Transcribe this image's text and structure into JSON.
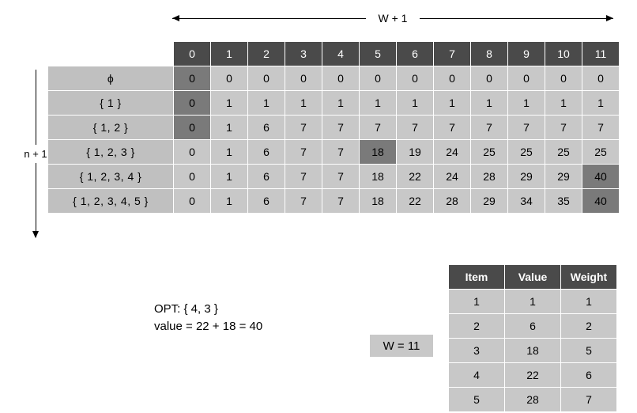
{
  "annotations": {
    "top_arrow_label": "W + 1",
    "left_arrow_label": "n + 1"
  },
  "dp_table": {
    "column_headers": [
      "0",
      "1",
      "2",
      "3",
      "4",
      "5",
      "6",
      "7",
      "8",
      "9",
      "10",
      "11"
    ],
    "row_labels": [
      "ϕ",
      "{ 1 }",
      "{ 1, 2 }",
      "{ 1, 2, 3 }",
      "{ 1, 2, 3, 4 }",
      "{ 1, 2, 3, 4, 5 }"
    ],
    "rows": [
      {
        "label": "ϕ",
        "values": [
          "0",
          "0",
          "0",
          "0",
          "0",
          "0",
          "0",
          "0",
          "0",
          "0",
          "0",
          "0"
        ],
        "highlighted": [
          0
        ]
      },
      {
        "label": "{ 1 }",
        "values": [
          "0",
          "1",
          "1",
          "1",
          "1",
          "1",
          "1",
          "1",
          "1",
          "1",
          "1",
          "1"
        ],
        "highlighted": [
          0
        ]
      },
      {
        "label": "{ 1, 2 }",
        "values": [
          "0",
          "1",
          "6",
          "7",
          "7",
          "7",
          "7",
          "7",
          "7",
          "7",
          "7",
          "7"
        ],
        "highlighted": [
          0
        ]
      },
      {
        "label": "{ 1, 2, 3 }",
        "values": [
          "0",
          "1",
          "6",
          "7",
          "7",
          "18",
          "19",
          "24",
          "25",
          "25",
          "25",
          "25"
        ],
        "highlighted": [
          5
        ]
      },
      {
        "label": "{ 1, 2, 3, 4 }",
        "values": [
          "0",
          "1",
          "6",
          "7",
          "7",
          "18",
          "22",
          "24",
          "28",
          "29",
          "29",
          "40"
        ],
        "highlighted": [
          11
        ]
      },
      {
        "label": "{ 1, 2, 3, 4, 5 }",
        "values": [
          "0",
          "1",
          "6",
          "7",
          "7",
          "18",
          "22",
          "28",
          "29",
          "34",
          "35",
          "40"
        ],
        "highlighted": [
          11
        ]
      }
    ]
  },
  "opt": {
    "line1": "OPT:  { 4, 3 }",
    "line2": "value = 22 + 18 = 40"
  },
  "capacity_badge": {
    "label": "W = 11"
  },
  "items_table": {
    "headers": [
      "Item",
      "Value",
      "Weight"
    ],
    "rows": [
      [
        "1",
        "1",
        "1"
      ],
      [
        "2",
        "6",
        "2"
      ],
      [
        "3",
        "18",
        "5"
      ],
      [
        "4",
        "22",
        "6"
      ],
      [
        "5",
        "28",
        "7"
      ]
    ]
  },
  "colors": {
    "header_bg": "#4a4a4a",
    "cell_bg": "#c8c8c8",
    "highlight_bg": "#7a7a7a",
    "rowlabel_bg": "#c0c0c0",
    "page_bg": "#ffffff",
    "text": "#000000",
    "header_text": "#ffffff"
  }
}
